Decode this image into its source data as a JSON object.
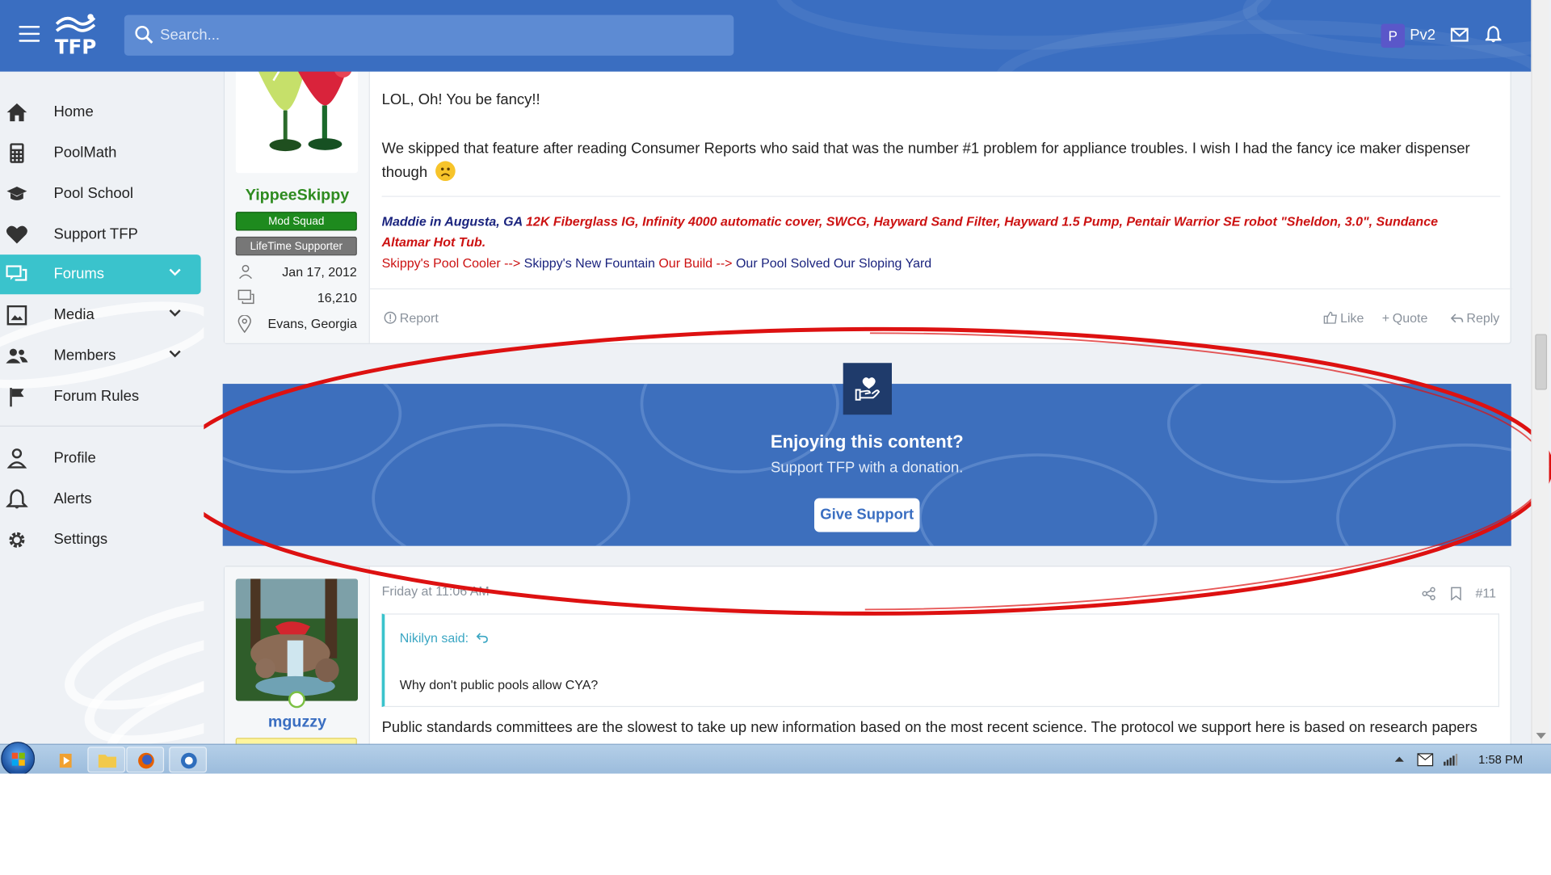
{
  "header": {
    "logo_text": "TFP",
    "search_placeholder": "Search...",
    "user_initial": "P",
    "user_name": "Pv2"
  },
  "sidebar": {
    "items": [
      {
        "label": "Home",
        "icon": "home-icon"
      },
      {
        "label": "PoolMath",
        "icon": "calculator-icon"
      },
      {
        "label": "Pool School",
        "icon": "graduation-cap-icon"
      },
      {
        "label": "Support TFP",
        "icon": "heart-icon"
      },
      {
        "label": "Forums",
        "icon": "comments-icon",
        "active": true
      },
      {
        "label": "Media",
        "icon": "image-icon"
      },
      {
        "label": "Members",
        "icon": "users-icon"
      },
      {
        "label": "Forum Rules",
        "icon": "flag-icon"
      }
    ],
    "account": [
      {
        "label": "Profile",
        "icon": "user-icon"
      },
      {
        "label": "Alerts",
        "icon": "bell-icon"
      },
      {
        "label": "Settings",
        "icon": "gear-icon"
      }
    ]
  },
  "post1": {
    "username": "YippeeSkippy",
    "badge_primary": "Mod Squad",
    "badge_secondary": "LifeTime Supporter",
    "joined": "Jan 17, 2012",
    "messages": "16,210",
    "location": "Evans, Georgia",
    "body_line1": "LOL, Oh! You be fancy!!",
    "body_line2": "We skipped that feature after reading Consumer Reports who said that was the number #1 problem for appliance troubles. I wish I had the fancy ice maker dispenser",
    "body_line3": "though",
    "sig_name": "Maddie in Augusta, GA",
    "sig_equipment_1": "12K Fiberglass IG, Infinity 4000 automatic cover, SWCG, Hayward Sand Filter, Hayward 1.5 Pump, Pentair Warrior SE robot \"Sheldon, 3.0\", Sundance",
    "sig_equipment_2": "Altamar Hot Tub.",
    "sig_link1_prefix": "Skippy's Pool Cooler -->",
    "sig_link1": "Skippy's New Fountain",
    "sig_link2_prefix": "Our Build -->",
    "sig_link2": "Our Pool Solved Our Sloping Yard",
    "report": "Report",
    "like": "Like",
    "quote": "Quote",
    "reply": "Reply"
  },
  "banner": {
    "title": "Enjoying this content?",
    "subtitle": "Support TFP with a donation.",
    "button": "Give Support"
  },
  "post2": {
    "username": "mguzzy",
    "timestamp": "Friday at 11:06 AM",
    "post_number": "#11",
    "quote_author": "Nikilyn said:",
    "quote_text": "Why don't public pools allow CYA?",
    "body": "Public standards committees are the slowest to take up new information based on the most recent science. The protocol we support here is based on research papers"
  },
  "taskbar": {
    "time": "1:58 PM"
  },
  "colors": {
    "brand_blue": "#3a6ec1",
    "active_teal": "#3ac3cc",
    "username_green": "#2e8b1f",
    "mod_badge": "#1e8a1e",
    "sig_red": "#cc1111",
    "sig_navy": "#1a237e",
    "annotation_red": "#dd1111"
  }
}
